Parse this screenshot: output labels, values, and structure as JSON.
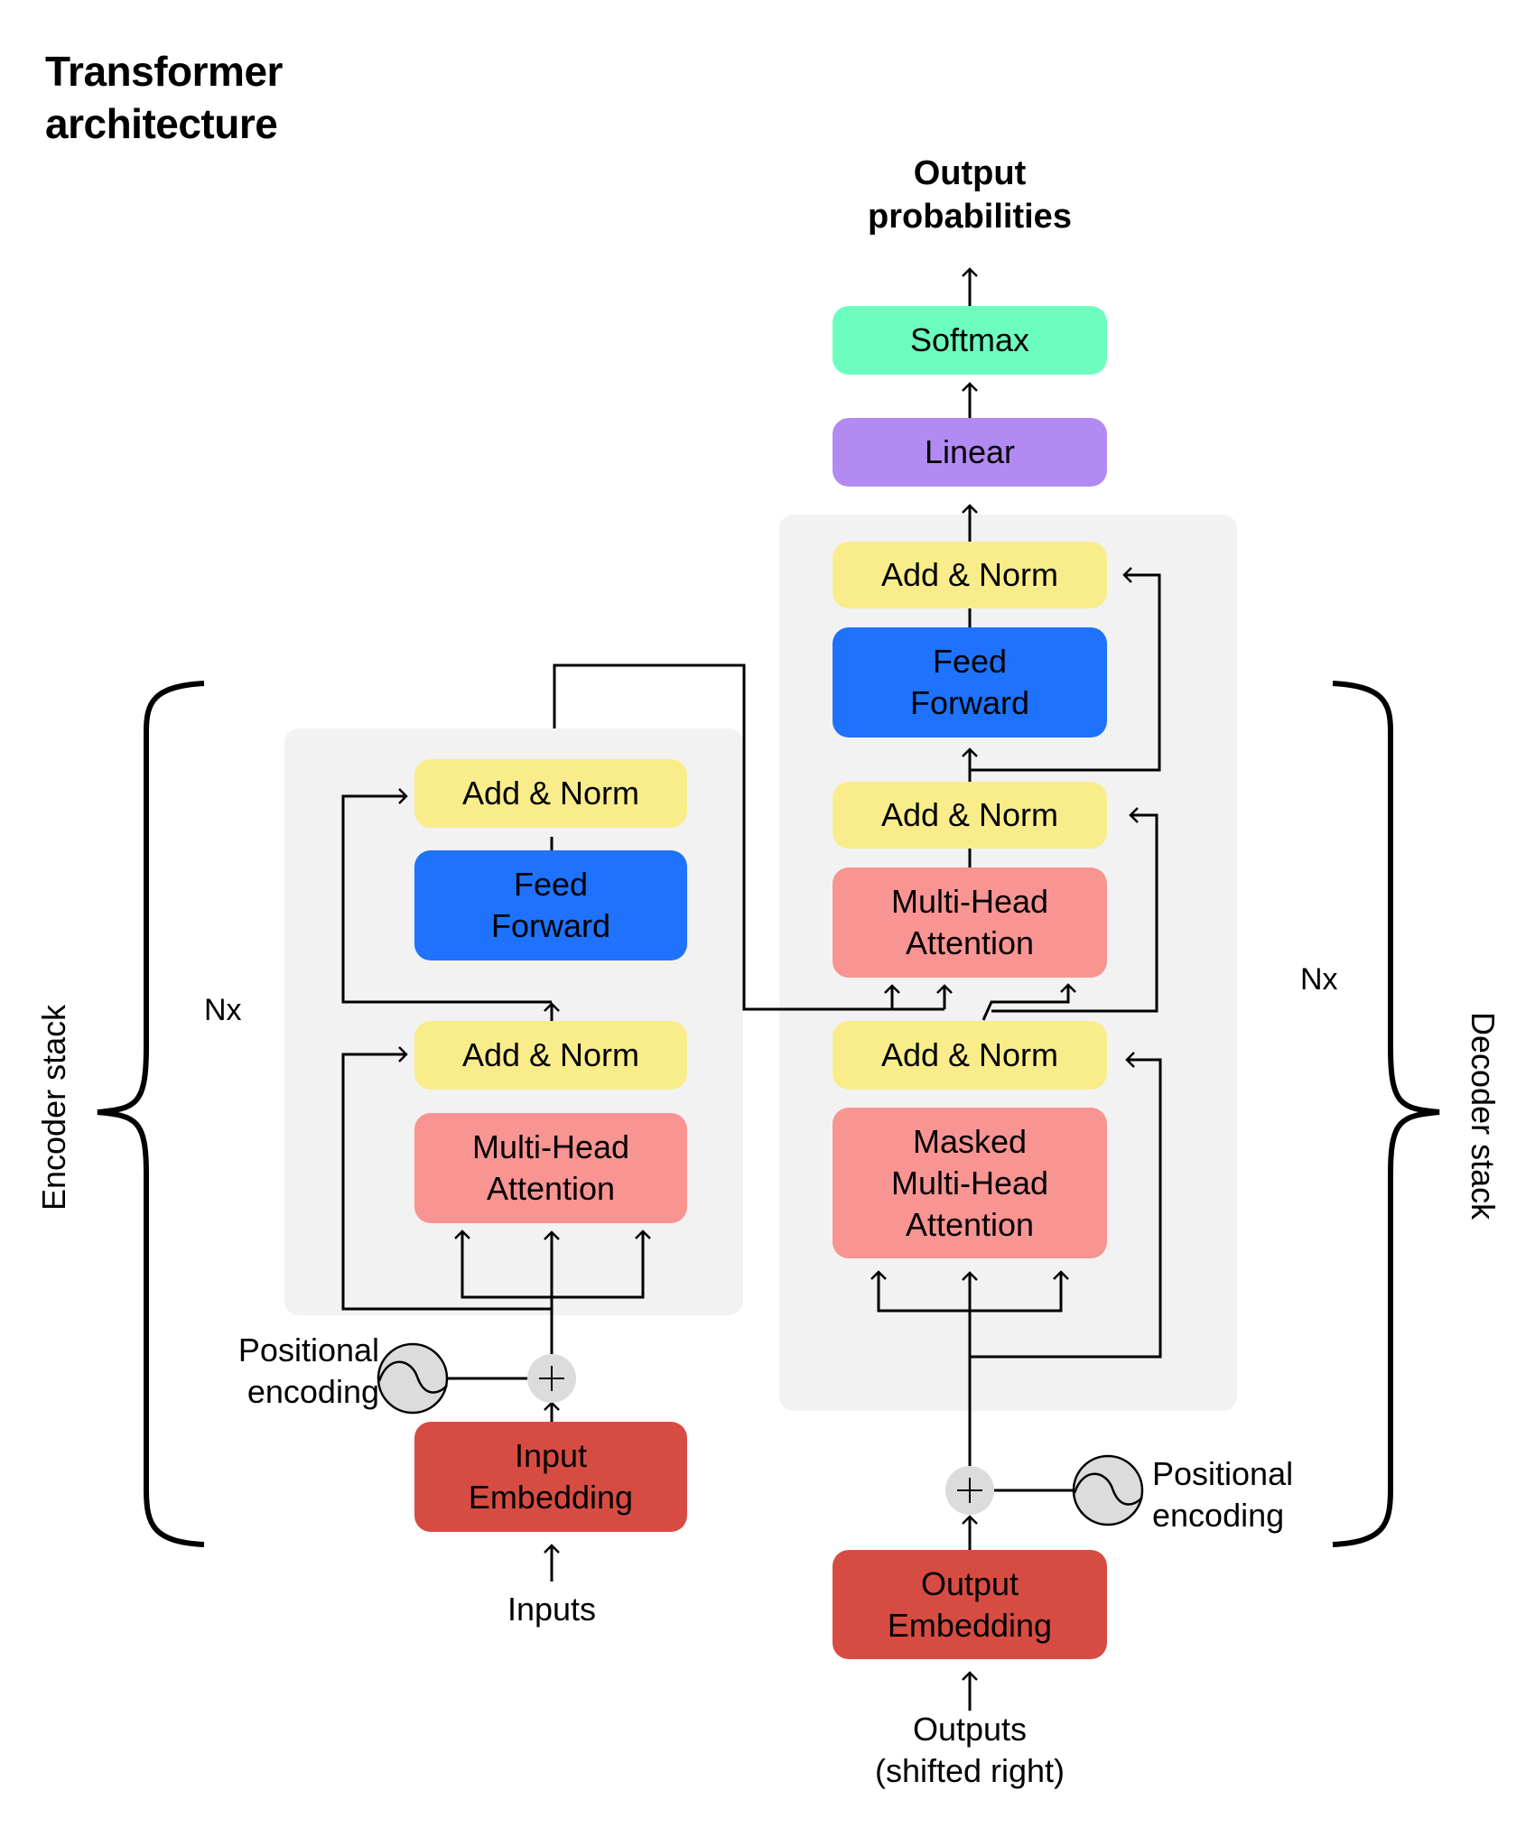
{
  "title": "Transformer\narchitecture",
  "colors": {
    "add_norm": "#f9ed8b",
    "feed_forward": "#1e72fb",
    "attention": "#f89492",
    "embedding": "#d64c43",
    "softmax": "#6cfebf",
    "linear": "#b28af2",
    "stack_background": "#f2f2f2"
  },
  "output_label": "Output\nprobabilities",
  "decoder_head": {
    "softmax": "Softmax",
    "linear": "Linear"
  },
  "encoder": {
    "stack_label": "Encoder stack",
    "repeat_label": "Nx",
    "add_norm_top": "Add & Norm",
    "feed_forward": "Feed\nForward",
    "add_norm_bottom": "Add & Norm",
    "attention": "Multi-Head\nAttention",
    "positional_encoding": "Positional\nencoding",
    "embedding": "Input\nEmbedding",
    "input_label": "Inputs"
  },
  "decoder": {
    "stack_label": "Decoder stack",
    "repeat_label": "Nx",
    "add_norm_top": "Add & Norm",
    "feed_forward": "Feed\nForward",
    "add_norm_middle": "Add & Norm",
    "cross_attention": "Multi-Head\nAttention",
    "add_norm_bottom": "Add & Norm",
    "masked_attention": "Masked\nMulti-Head\nAttention",
    "positional_encoding": "Positional\nencoding",
    "embedding": "Output\nEmbedding",
    "input_label": "Outputs\n(shifted right)"
  },
  "icons": {
    "add_operator": "plus-circle",
    "positional_encoding": "sine-wave-circle"
  }
}
